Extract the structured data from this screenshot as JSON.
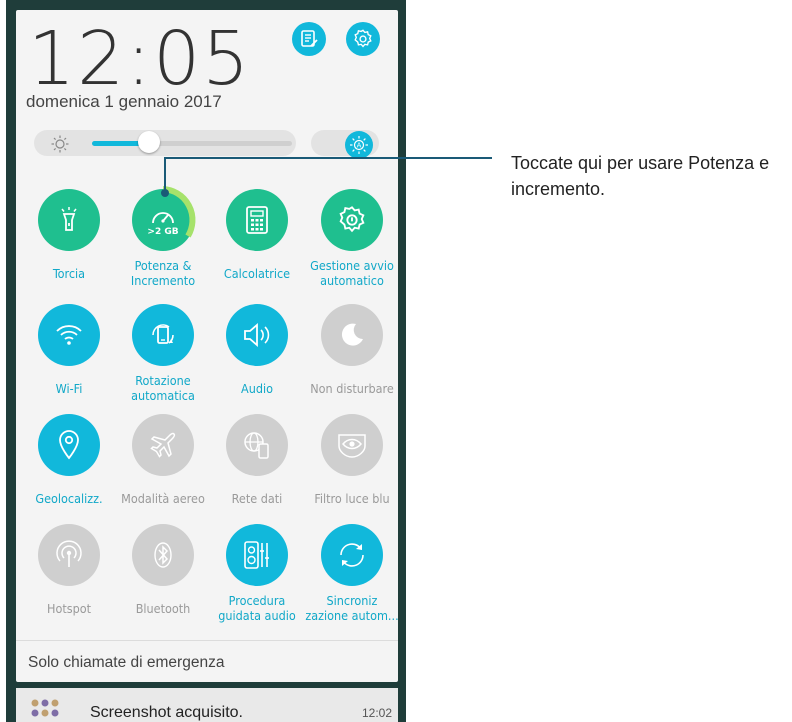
{
  "status": {
    "time": "12:05",
    "date": "domenica 1 gennaio 2017"
  },
  "header_buttons": [
    {
      "name": "notes-icon",
      "label": ""
    },
    {
      "name": "settings-icon",
      "label": ""
    }
  ],
  "brightness": {
    "level_percent": 27
  },
  "tiles": [
    {
      "label": "Torcia",
      "state": "green",
      "icon": "flashlight-icon"
    },
    {
      "label": "Potenza &\nIncremento",
      "state": "green",
      "icon": "speedometer-icon",
      "badge": ">2 GB"
    },
    {
      "label": "Calcolatrice",
      "state": "green",
      "icon": "calculator-icon"
    },
    {
      "label": "Gestione avvio\nautomatico",
      "state": "green",
      "icon": "gear-icon"
    },
    {
      "label": "Wi-Fi",
      "state": "on",
      "icon": "wifi-icon"
    },
    {
      "label": "Rotazione\nautomatica",
      "state": "on",
      "icon": "rotation-icon"
    },
    {
      "label": "Audio",
      "state": "on",
      "icon": "speaker-icon"
    },
    {
      "label": "Non disturbare",
      "state": "off",
      "icon": "moon-icon"
    },
    {
      "label": "Geolocalizz.",
      "state": "on",
      "icon": "location-pin-icon"
    },
    {
      "label": "Modalità aereo",
      "state": "off",
      "icon": "airplane-icon"
    },
    {
      "label": "Rete dati",
      "state": "off",
      "icon": "globe-phone-icon"
    },
    {
      "label": "Filtro luce blu",
      "state": "off",
      "icon": "eye-icon"
    },
    {
      "label": "Hotspot",
      "state": "off",
      "icon": "hotspot-icon"
    },
    {
      "label": "Bluetooth",
      "state": "off",
      "icon": "bluetooth-icon"
    },
    {
      "label": "Procedura\nguidata audio",
      "state": "on",
      "icon": "equalizer-icon"
    },
    {
      "label": "Sincroniz\nzazione autom...",
      "state": "on",
      "icon": "sync-icon"
    }
  ],
  "footer": {
    "emergency": "Solo chiamate di emergenza"
  },
  "notification": {
    "title": "Screenshot acquisito.",
    "time": "12:02"
  },
  "callout": {
    "text": "Toccate qui per usare Potenza e\nincremento."
  },
  "colors": {
    "accent": "#11b8db",
    "green": "#1fbf8f",
    "disabled": "#cfcfcf"
  }
}
